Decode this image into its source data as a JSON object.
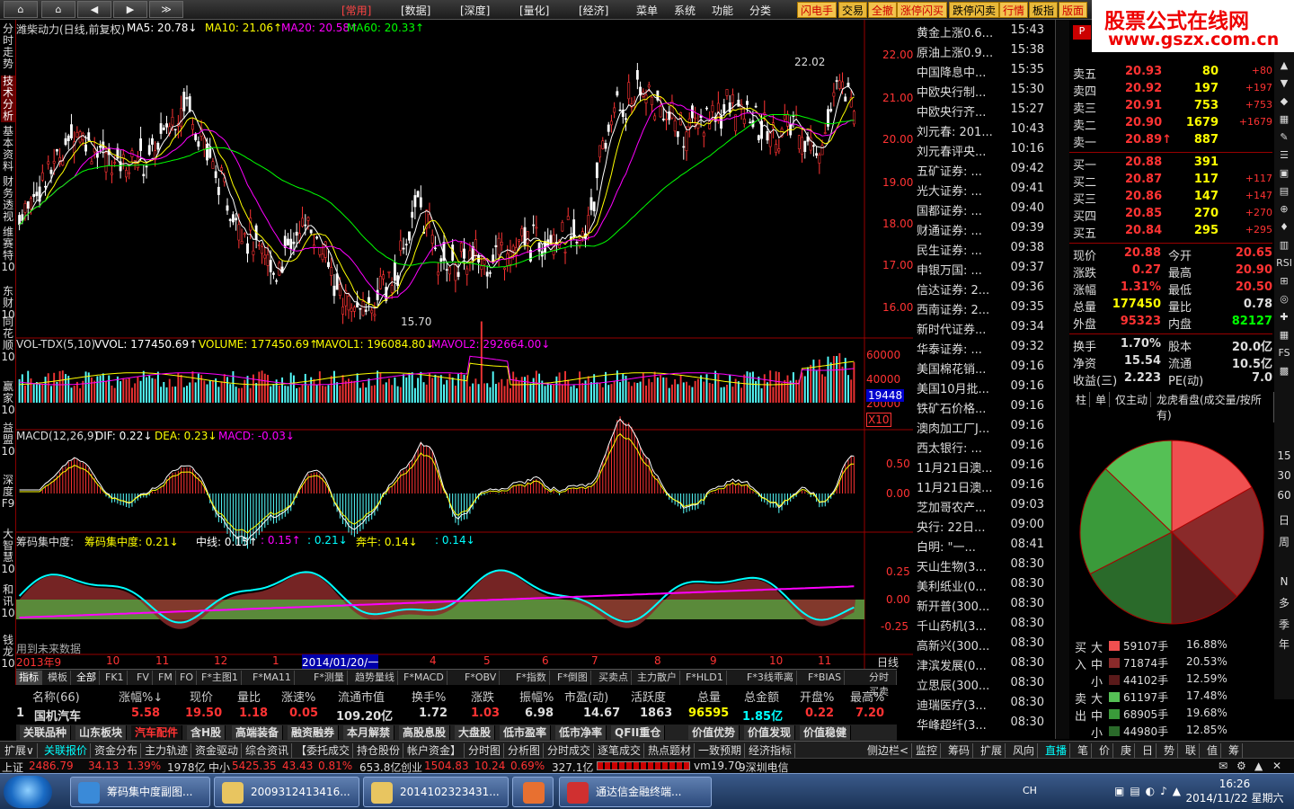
{
  "topnav": {
    "buttons": [
      "⌂",
      "◀",
      "▶",
      "≫"
    ],
    "menu": [
      "[常用]",
      "[数据]",
      "[深度]",
      "[量化]",
      "[经济]",
      "菜单",
      "系统",
      "功能",
      "分类"
    ],
    "quick": [
      "闪电手",
      "交易",
      "全撤",
      "涨停闪买",
      "跌停闪卖",
      "行情",
      "板指",
      "版面"
    ]
  },
  "logo": {
    "line1": "股票公式在线网",
    "line2": "www.gszx.com.cn"
  },
  "lefttabs": [
    "分时走势",
    "技术分析",
    "基本资料",
    "财务透视",
    "维赛特10",
    "东财10",
    "同花顺10",
    "赢家10",
    "益盟10",
    "深度F9",
    "大智慧10",
    "和讯10",
    "钱龙10"
  ],
  "main": {
    "header": {
      "stock": "潍柴动力(日线,前复权)",
      "ma5": "MA5: 20.78↓",
      "ma10": "MA10: 21.06↑",
      "ma20": "MA20: 20.58↑",
      "ma60": "MA60: 20.33↑"
    },
    "price_axis": [
      "22.00",
      "21.00",
      "20.00",
      "19.00",
      "18.00",
      "17.00",
      "16.00"
    ],
    "high_label": "22.02",
    "low_label": "15.70",
    "vol": {
      "name": "VOL-TDX(5,10)",
      "vvol": "VVOL: 177450.69↑",
      "volume": "VOLUME: 177450.69↑",
      "mavol1": "MAVOL1: 196084.80↓",
      "mavol2": "MAVOL2: 292664.00↓",
      "axis": [
        "60000",
        "40000",
        "20000"
      ],
      "current": "19448",
      "x10": "X10"
    },
    "macd": {
      "name": "MACD(12,26,9)",
      "dif": "DIF: 0.22↓",
      "dea": "DEA: 0.23↓",
      "macd": "MACD: -0.03↓",
      "axis": [
        "0.50",
        "0.00"
      ]
    },
    "chip": {
      "name": "筹码集中度:",
      "c1": "筹码集中度: 0.21↓",
      "c2": "中线: 0.15↑",
      "c3": ": 0.15↑",
      "c4": ": 0.21↓",
      "c5": "奔牛: 0.14↓",
      "c6": ": 0.14↓",
      "axis": [
        "0.25",
        "0.00",
        "-0.25"
      ],
      "note": "用到未来数据"
    },
    "xaxis": [
      "2013年9",
      "10",
      "11",
      "12",
      "1",
      "2014/01/20/一",
      "4",
      "5",
      "6",
      "7",
      "8",
      "9",
      "10",
      "11"
    ],
    "period": "日线"
  },
  "tabs_row": [
    "指标",
    "模板",
    "全部",
    "FK1",
    "FV",
    "FM",
    "FO",
    "F*主图1",
    "F*MA11",
    "F*测量",
    "趋势量线",
    "F*MACD",
    "F*OBV",
    "F*指数",
    "F*倒图",
    "买卖点",
    "主力散户",
    "F*HLD1",
    "F*3线乖离",
    "F*BIAS",
    "分时买卖",
    "分时涨停"
  ],
  "list": {
    "headers": [
      "名称(66)",
      "涨幅%↓",
      "现价",
      "量比",
      "涨速%",
      "流通市值",
      "换手%",
      "涨跌",
      "振幅%",
      "市盈(动)",
      "活跃度",
      "总量",
      "总金额",
      "开盘%",
      "最高%"
    ],
    "row": [
      "1",
      "国机汽车",
      "5.58",
      "19.50",
      "1.18",
      "0.05",
      "109.20亿",
      "1.72",
      "1.03",
      "6.98",
      "14.67",
      "1863",
      "96595",
      "1.85亿",
      "0.22",
      "7.20"
    ]
  },
  "categories": [
    "关联品种",
    "山东板块",
    "汽车配件",
    "含H股",
    "高端装备",
    "融资融券",
    "本月解禁",
    "高股息股",
    "大盘股",
    "低市盈率",
    "低市净率",
    "QFII重仓",
    "价值优势",
    "价值发现",
    "价值稳健"
  ],
  "func_row": [
    "扩展∨",
    "关联报价",
    "资金分布",
    "主力轨迹",
    "资金驱动",
    "综合资讯",
    "【委托成交",
    "持仓股份",
    "帐户资金】",
    "分时图",
    "分析图",
    "分时成交",
    "逐笔成交",
    "热点题材",
    "一致预期",
    "经济指标"
  ],
  "func_right": [
    "侧边栏<",
    "监控",
    "筹码",
    "扩展",
    "风向",
    "直播",
    "笔",
    "价",
    "庚",
    "日",
    "势",
    "联",
    "值",
    "筹"
  ],
  "status": {
    "sh": "上证",
    "sh_v": "2486.79",
    "sh_c": "34.13",
    "sh_p": "1.39%",
    "sh_a": "1978亿",
    "zx": "中小",
    "zx_v": "5425.35",
    "zx_c": "43.43",
    "zx_p": "0.81%",
    "zx_a": "653.8亿",
    "cy": "创业",
    "cy_v": "1504.83",
    "cy_c": "10.24",
    "cy_p": "0.69%",
    "cy_a": "327.1亿",
    "ver": "vm19.70",
    "srv": "9深圳电信"
  },
  "news": [
    [
      "黄金上涨0.6...",
      "15:43"
    ],
    [
      "原油上涨0.9...",
      "15:38"
    ],
    [
      "中国降息中...",
      "15:35"
    ],
    [
      "中欧央行制...",
      "15:30"
    ],
    [
      "中欧央行齐...",
      "15:27"
    ],
    [
      "刘元春: 201...",
      "10:43"
    ],
    [
      "刘元春评央...",
      "10:16"
    ],
    [
      "五矿证券: ...",
      "09:42"
    ],
    [
      "光大证券: ...",
      "09:41"
    ],
    [
      "国都证券: ...",
      "09:40"
    ],
    [
      "财通证券: ...",
      "09:39"
    ],
    [
      "民生证券: ...",
      "09:38"
    ],
    [
      "申银万国: ...",
      "09:37"
    ],
    [
      "信达证券: 2...",
      "09:36"
    ],
    [
      "西南证券: 2...",
      "09:35"
    ],
    [
      "新时代证券...",
      "09:34"
    ],
    [
      "华泰证券: ...",
      "09:32"
    ],
    [
      "美国棉花销...",
      "09:16"
    ],
    [
      "美国10月批...",
      "09:16"
    ],
    [
      "铁矿石价格...",
      "09:16"
    ],
    [
      "澳肉加工厂J...",
      "09:16"
    ],
    [
      "西太银行: ...",
      "09:16"
    ],
    [
      "11月21日澳...",
      "09:16"
    ],
    [
      "11月21日澳...",
      "09:16"
    ],
    [
      "芝加哥农产...",
      "09:03"
    ],
    [
      "央行: 22日...",
      "09:00"
    ],
    [
      "白明: \"一...",
      "08:41"
    ],
    [
      "天山生物(3...",
      "08:30"
    ],
    [
      "美利纸业(0...",
      "08:30"
    ],
    [
      "新开普(300...",
      "08:30"
    ],
    [
      "千山药机(3...",
      "08:30"
    ],
    [
      "高新兴(300...",
      "08:30"
    ],
    [
      "津滨发展(0...",
      "08:30"
    ],
    [
      "立思辰(300...",
      "08:30"
    ],
    [
      "迪瑞医疗(3...",
      "08:30"
    ],
    [
      "华峰超纤(3...",
      "08:30"
    ]
  ],
  "quote": {
    "sells": [
      [
        "卖五",
        "20.93",
        "80",
        "+80"
      ],
      [
        "卖四",
        "20.92",
        "197",
        "+197"
      ],
      [
        "卖三",
        "20.91",
        "753",
        "+753"
      ],
      [
        "卖二",
        "20.90",
        "1679",
        "+1679"
      ],
      [
        "卖一",
        "20.89↑",
        "887",
        ""
      ]
    ],
    "buys": [
      [
        "买一",
        "20.88",
        "391",
        ""
      ],
      [
        "买二",
        "20.87",
        "117",
        "+117"
      ],
      [
        "买三",
        "20.86",
        "147",
        "+147"
      ],
      [
        "买四",
        "20.85",
        "270",
        "+270"
      ],
      [
        "买五",
        "20.84",
        "295",
        "+295"
      ]
    ],
    "stats": [
      [
        "现价",
        "20.88",
        "今开",
        "20.65"
      ],
      [
        "涨跌",
        "0.27",
        "最高",
        "20.90"
      ],
      [
        "涨幅",
        "1.31%",
        "最低",
        "20.50"
      ],
      [
        "总量",
        "177450",
        "量比",
        "0.78"
      ],
      [
        "外盘",
        "95323",
        "内盘",
        "82127"
      ],
      [
        "换手",
        "1.70%",
        "股本",
        "20.0亿"
      ],
      [
        "净资",
        "15.54",
        "流通",
        "10.5亿"
      ],
      [
        "收益(三)",
        "2.223",
        "PE(动)",
        "7.0"
      ]
    ],
    "tabs": [
      "柱",
      "单",
      "仅主动",
      "龙虎看盘(成交量/按所有)"
    ],
    "flow": [
      [
        "买",
        "大",
        "59107手",
        "16.88%"
      ],
      [
        "入",
        "中",
        "71874手",
        "20.53%"
      ],
      [
        "",
        "小",
        "44102手",
        "12.59%"
      ],
      [
        "卖",
        "大",
        "61197手",
        "17.48%"
      ],
      [
        "出",
        "中",
        "68905手",
        "19.68%"
      ],
      [
        "",
        "小",
        "44980手",
        "12.85%"
      ]
    ]
  },
  "chart_data": {
    "type": "pie",
    "values": [
      16.88,
      20.53,
      12.59,
      17.48,
      19.68,
      12.85
    ],
    "colors": [
      "#f05050",
      "#8a2a2a",
      "#5a1a1a",
      "#2a6a2a",
      "#3a9a3a",
      "#55c055"
    ]
  },
  "right_icons": [
    "周",
    "多",
    "季",
    "年",
    "日",
    "15",
    "30",
    "60",
    "N",
    "RSI"
  ],
  "taskbar": {
    "tasks": [
      "筹码集中度副图...",
      "2009312413416...",
      "2014102323431...",
      "",
      "通达信金融终端..."
    ],
    "time": "16:26",
    "date": "2014/11/22 星期六",
    "ch": "CH"
  }
}
